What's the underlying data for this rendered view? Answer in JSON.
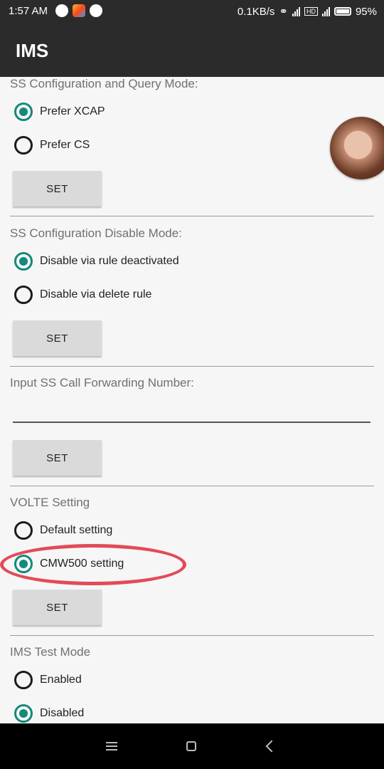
{
  "status_bar": {
    "time": "1:57 AM",
    "network_speed": "0.1KB/s",
    "battery": "95%",
    "icons": [
      "messenger-icon",
      "photos-icon",
      "messenger-icon",
      "headset-icon",
      "signal-3g-icon",
      "hd-icon",
      "signal-4g-icon",
      "battery-icon"
    ]
  },
  "app_bar": {
    "title": "IMS"
  },
  "sections": [
    {
      "label": "SS Configuration and Query Mode:",
      "options": [
        {
          "label": "Prefer XCAP",
          "selected": true
        },
        {
          "label": "Prefer CS",
          "selected": false
        }
      ],
      "button": "SET"
    },
    {
      "label": "SS Configuration Disable Mode:",
      "options": [
        {
          "label": "Disable via rule deactivated",
          "selected": true
        },
        {
          "label": "Disable via delete rule",
          "selected": false
        }
      ],
      "button": "SET"
    },
    {
      "label": "Input SS Call Forwarding Number:",
      "input_value": "",
      "input_placeholder": "",
      "button": "SET"
    },
    {
      "label": "VOLTE Setting",
      "options": [
        {
          "label": "Default setting",
          "selected": false
        },
        {
          "label": "CMW500 setting",
          "selected": true
        }
      ],
      "button": "SET"
    },
    {
      "label": "IMS Test Mode",
      "options": [
        {
          "label": "Enabled",
          "selected": false
        },
        {
          "label": "Disabled",
          "selected": true
        }
      ]
    }
  ],
  "colors": {
    "accent": "#138a7a",
    "bar": "#2b2b2b",
    "annotation": "#e24b57"
  },
  "nav_bar": {
    "icons": [
      "menu-icon",
      "home-icon",
      "back-icon"
    ]
  }
}
